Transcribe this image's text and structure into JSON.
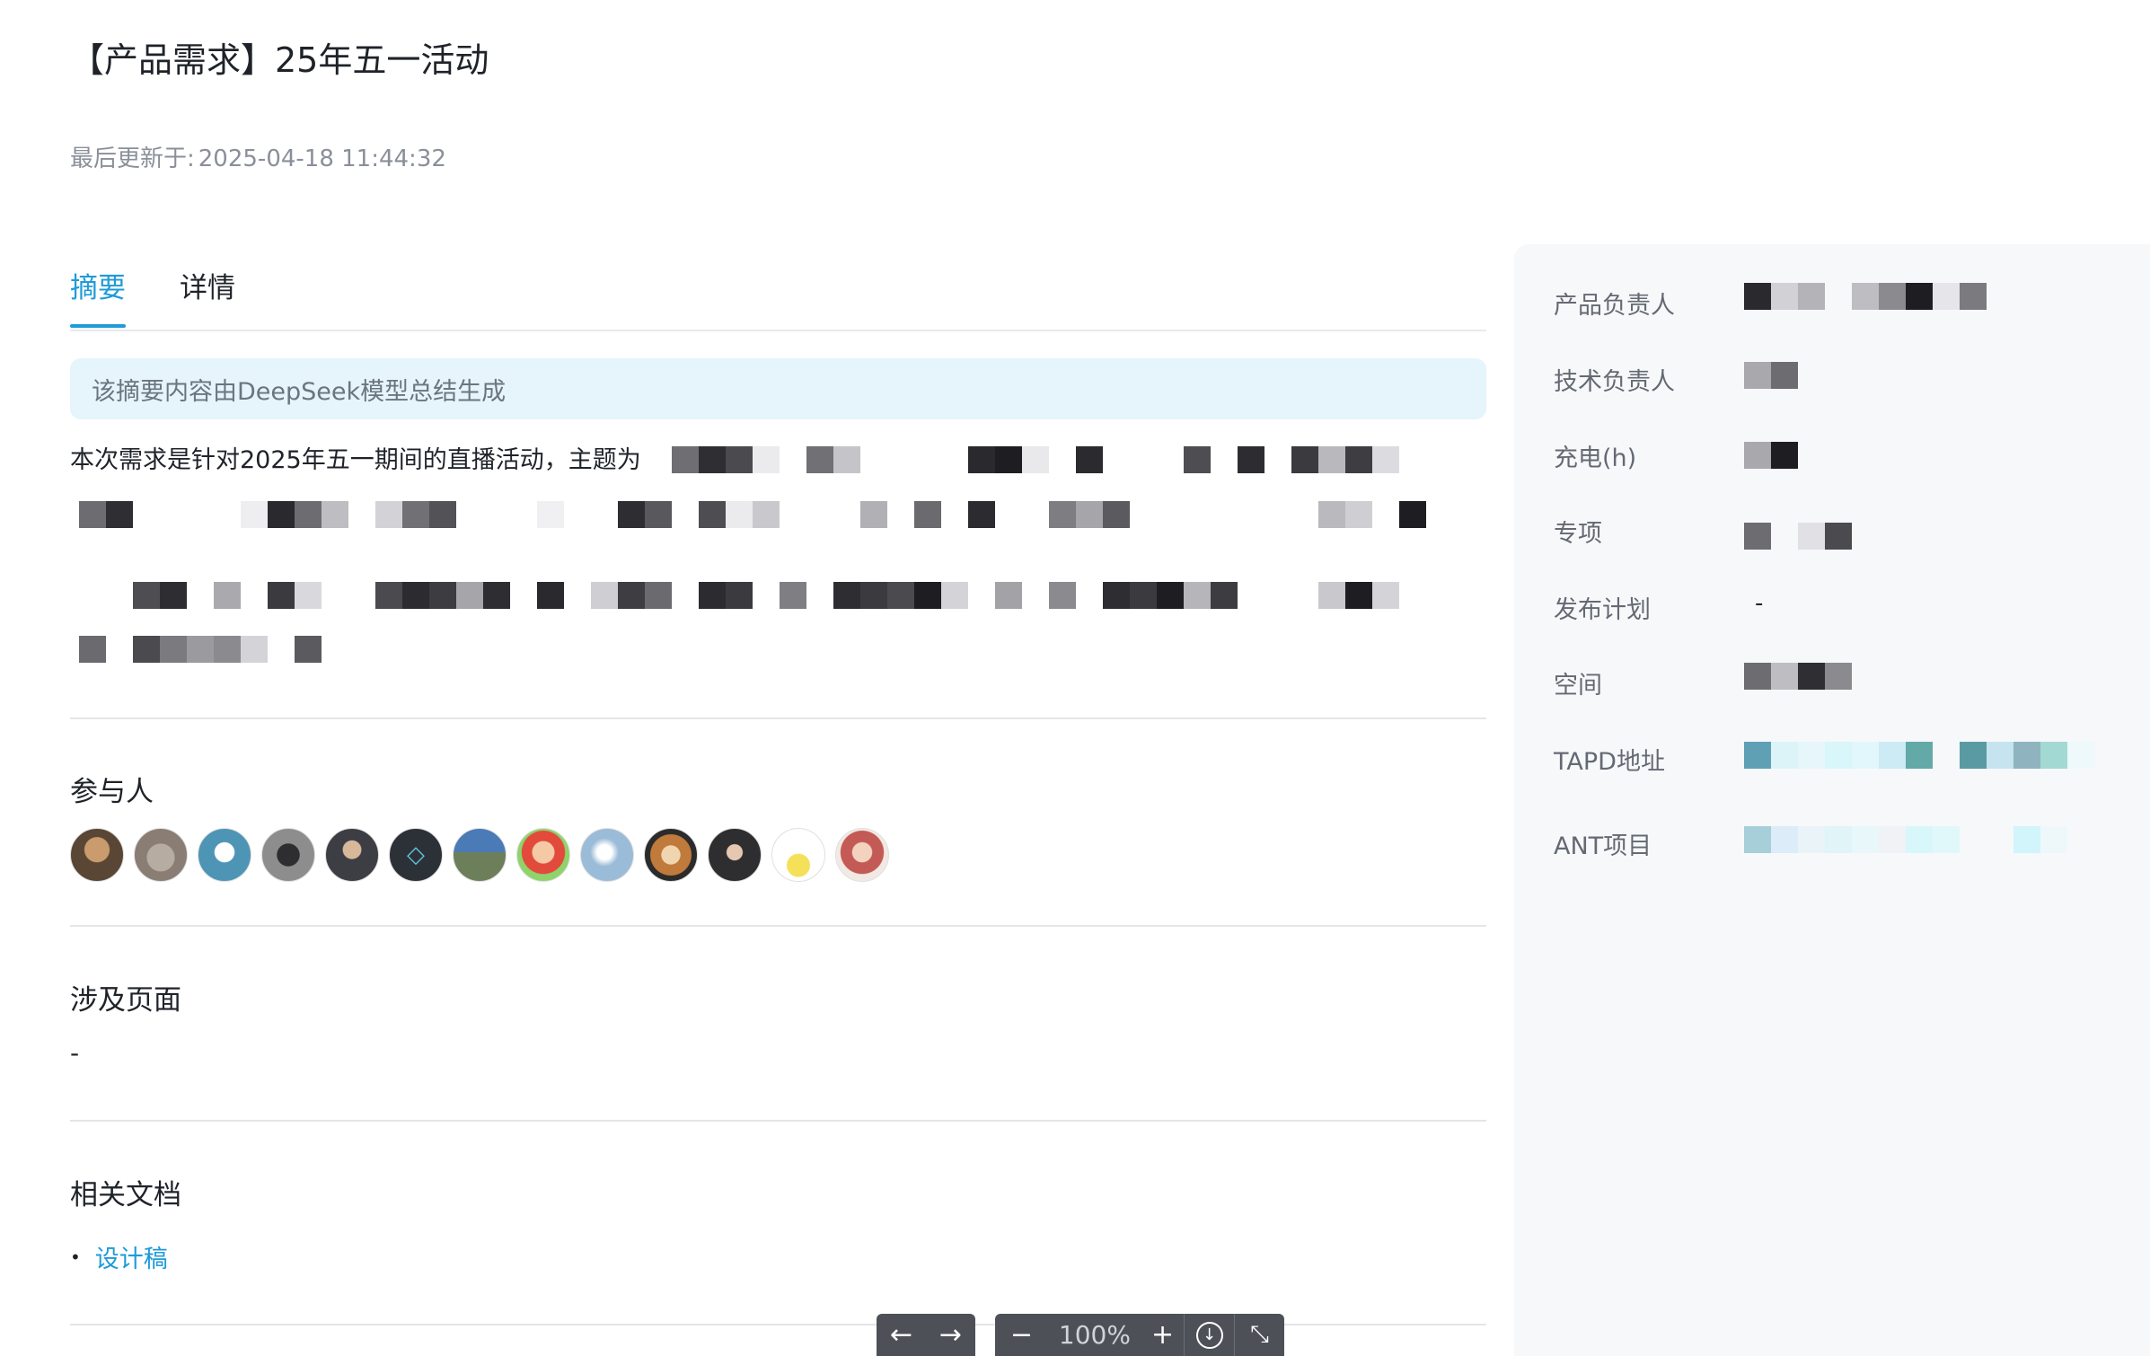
{
  "page": {
    "title": "【产品需求】25年五一活动",
    "updated_label": "最后更新于:",
    "updated_value": "2025-04-18 11:44:32"
  },
  "tabs": [
    {
      "label": "摘要",
      "active": true
    },
    {
      "label": "详情",
      "active": false
    }
  ],
  "summary": {
    "ai_notice": "该摘要内容由DeepSeek模型总结生成",
    "text_visible": "本次需求是针对2025年五一期间的直播活动，主题为"
  },
  "participants": {
    "title": "参与人",
    "avatars": [
      {
        "name": "avatar-1",
        "color": "#5a4634"
      },
      {
        "name": "avatar-2",
        "color": "#9c8f85"
      },
      {
        "name": "avatar-3",
        "color": "#4e94b5"
      },
      {
        "name": "avatar-4",
        "color": "#6b6b6b"
      },
      {
        "name": "avatar-5",
        "color": "#3c3e44"
      },
      {
        "name": "avatar-6",
        "color": "#2c3138"
      },
      {
        "name": "avatar-7",
        "color": "#6d7f5a"
      },
      {
        "name": "avatar-8",
        "color": "#e24a3b"
      },
      {
        "name": "avatar-9",
        "color": "#9bbcd8"
      },
      {
        "name": "avatar-10",
        "color": "#c07a3b"
      },
      {
        "name": "avatar-11",
        "color": "#2e2e30"
      },
      {
        "name": "avatar-12",
        "color": "#f5e05a"
      },
      {
        "name": "avatar-13",
        "color": "#c45a55"
      }
    ]
  },
  "pages": {
    "title": "涉及页面",
    "value": "-"
  },
  "docs": {
    "title": "相关文档",
    "items": [
      {
        "label": "设计稿"
      }
    ]
  },
  "properties": [
    {
      "label": "产品负责人"
    },
    {
      "label": "技术负责人"
    },
    {
      "label": "充电(h)"
    },
    {
      "label": "专项"
    },
    {
      "label": "发布计划",
      "value": "-"
    },
    {
      "label": "空间"
    },
    {
      "label": "TAPD地址"
    },
    {
      "label": "ANT项目"
    }
  ],
  "toolbar": {
    "prev_icon": "arrow-left-icon",
    "next_icon": "arrow-right-icon",
    "zoom_out_icon": "minus-icon",
    "zoom_level": "100%",
    "zoom_in_icon": "plus-icon",
    "download_icon": "download-icon",
    "collapse_icon": "collapse-icon"
  },
  "colors": {
    "accent": "#1f9bd8",
    "banner_bg": "#e6f4fb",
    "panel_bg": "#f7f8fa",
    "toolbar_bg": "#4d5157"
  }
}
